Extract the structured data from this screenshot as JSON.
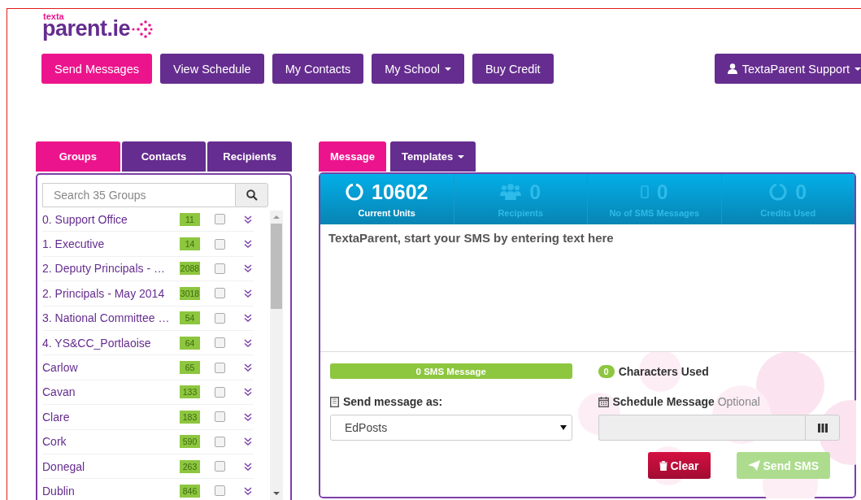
{
  "logo": {
    "small": "texta",
    "main": "parent.ie"
  },
  "nav": [
    {
      "label": "Send Messages",
      "selected": true,
      "has_menu": false
    },
    {
      "label": "View Schedule",
      "selected": false,
      "has_menu": false
    },
    {
      "label": "My Contacts",
      "selected": false,
      "has_menu": false
    },
    {
      "label": "My School",
      "selected": false,
      "has_menu": true
    },
    {
      "label": "Buy Credit",
      "selected": false,
      "has_menu": false
    }
  ],
  "user_menu": {
    "label": "TextaParent Support"
  },
  "left_tabs": [
    {
      "label": "Groups",
      "selected": true
    },
    {
      "label": "Contacts",
      "selected": false
    },
    {
      "label": "Recipients",
      "selected": false
    }
  ],
  "search": {
    "placeholder": "Search 35 Groups"
  },
  "groups": [
    {
      "name": "0. Support Office",
      "count": "11",
      "checked": false
    },
    {
      "name": "1. Executive",
      "count": "14",
      "checked": false
    },
    {
      "name": "2. Deputy Principals - …",
      "count": "2088",
      "checked": false
    },
    {
      "name": "2. Principals - May 2014",
      "count": "3018",
      "checked": false
    },
    {
      "name": "3. National Committee …",
      "count": "54",
      "checked": false
    },
    {
      "name": "4. YS&CC_Portlaoise",
      "count": "64",
      "checked": false
    },
    {
      "name": "Carlow",
      "count": "65",
      "checked": false
    },
    {
      "name": "Cavan",
      "count": "133",
      "checked": false
    },
    {
      "name": "Clare",
      "count": "183",
      "checked": false
    },
    {
      "name": "Cork",
      "count": "590",
      "checked": false
    },
    {
      "name": "Donegal",
      "count": "263",
      "checked": false
    },
    {
      "name": "Dublin",
      "count": "846",
      "checked": false
    }
  ],
  "right_tabs": [
    {
      "label": "Message",
      "selected": true,
      "has_menu": false
    },
    {
      "label": "Templates",
      "selected": false,
      "has_menu": true
    }
  ],
  "stats": [
    {
      "kind": "units",
      "value": "10602",
      "label": "Current Units",
      "active": true
    },
    {
      "kind": "recipients",
      "value": "0",
      "label": "Recipients",
      "active": false
    },
    {
      "kind": "phone",
      "value": "0",
      "label": "No of SMS Messages",
      "active": false
    },
    {
      "kind": "credits",
      "value": "0",
      "label": "Credits Used",
      "active": false
    }
  ],
  "message": {
    "placeholder": "TextaParent, start your SMS by entering text here"
  },
  "sms_count": {
    "label": "0 SMS Message",
    "level": 1
  },
  "characters": {
    "count": "0",
    "label": "Characters Used"
  },
  "sender": {
    "label": "Send message as:",
    "value": "EdPosts"
  },
  "schedule": {
    "label": "Schedule Message",
    "hint": "Optional"
  },
  "buttons": [
    {
      "kind": "clear",
      "label": "Clear",
      "disabled": false
    },
    {
      "kind": "send",
      "label": "Send SMS",
      "disabled": true
    }
  ]
}
